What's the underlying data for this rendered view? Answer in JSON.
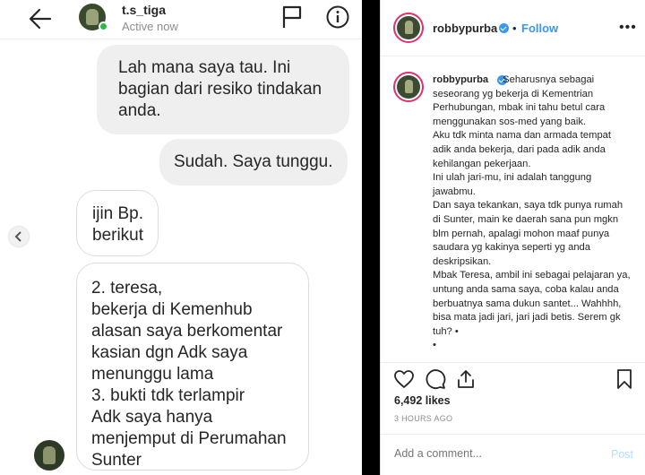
{
  "chat": {
    "header": {
      "username": "t.s_tiga",
      "status": "Active now"
    },
    "messages": [
      {
        "type": "sent",
        "text": "Lah mana saya tau. Ini\nbagian dari resiko tindakan\nanda."
      },
      {
        "type": "sent",
        "text": "Sudah. Saya tunggu."
      },
      {
        "type": "received",
        "text": "ijin Bp.\nberikut"
      },
      {
        "type": "received",
        "text": "2. teresa,\nbekerja di Kemenhub\nalasan saya berkomentar\nkasian dgn Adk saya\nmenunggu lama\n3. bukti tdk terlampir\nAdk saya hanya\nmenjemput di Perumahan\nSunter"
      }
    ]
  },
  "post": {
    "username": "robbypurba",
    "follow_label": "Follow",
    "separator": "•",
    "more_label": "•••",
    "caption": "Seharusnya sebagai seseorang yg bekerja di Kementrian Perhubungan, mbak ini tahu betul cara menggunakan sos-med yang baik.\nAku tdk minta nama dan armada tempat adik anda bekerja, dari pada adik anda kehilangan pekerjaan.\nIni ulah jari-mu, ini adalah tanggung jawabmu.\nDan saya tekankan, saya tdk punya rumah di Sunter, main ke daerah sana pun mgkn blm pernah, apalagi mohon maaf punya saudara yg kakinya seperti yg anda deskripsikan.\nMbak Teresa, ambil ini sebagai pelajaran ya, untung anda sama saya, coba kalau anda berbuatnya sama dukun santet... Wahhhh, bisa mata jadi jari, jari jadi betis. Serem gk tuh? •\n•",
    "likes": "6,492 likes",
    "time": "3 HOURS AGO",
    "comment_placeholder": "Add a comment...",
    "post_label": "Post"
  },
  "icons": [
    "back-arrow-icon",
    "flag-icon",
    "info-icon",
    "heart-icon",
    "comment-icon",
    "share-icon",
    "bookmark-icon",
    "verified-icon",
    "chevron-left-icon"
  ],
  "colors": {
    "link": "#3897f0",
    "online": "#2db84b",
    "muted": "#8e8e8e",
    "sent_bubble": "#efefef",
    "post_disabled": "#b2dffc"
  }
}
